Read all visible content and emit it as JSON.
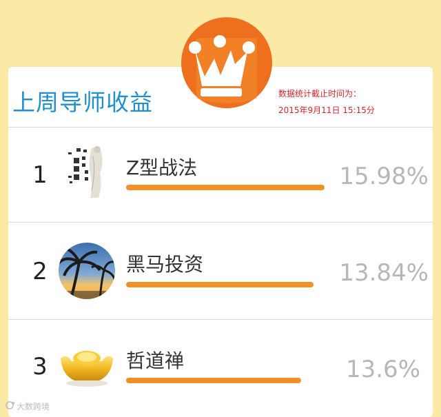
{
  "header": {
    "title": "上周导师收益",
    "stats_label": "数据统计截止时间为：",
    "stats_time": "2015年9月11日 15:15分",
    "badge_icon": "crown-icon"
  },
  "colors": {
    "title": "#1f8fd0",
    "bar": "#f0922a",
    "badge": "#ee6f1e",
    "stats": "#d6262b",
    "page_bg": "#fbe9a6"
  },
  "leaderboard": [
    {
      "rank": "1",
      "name": "Z型战法",
      "return": "15.98%",
      "avatar_icon": "calligraphy-portrait-avatar"
    },
    {
      "rank": "2",
      "name": "黑马投资",
      "return": "13.84%",
      "avatar_icon": "palm-tree-sunset-avatar"
    },
    {
      "rank": "3",
      "name": "哲道禅",
      "return": "13.6%",
      "avatar_icon": "gold-ingot-avatar"
    }
  ],
  "watermark": {
    "text": "大数跨境"
  }
}
